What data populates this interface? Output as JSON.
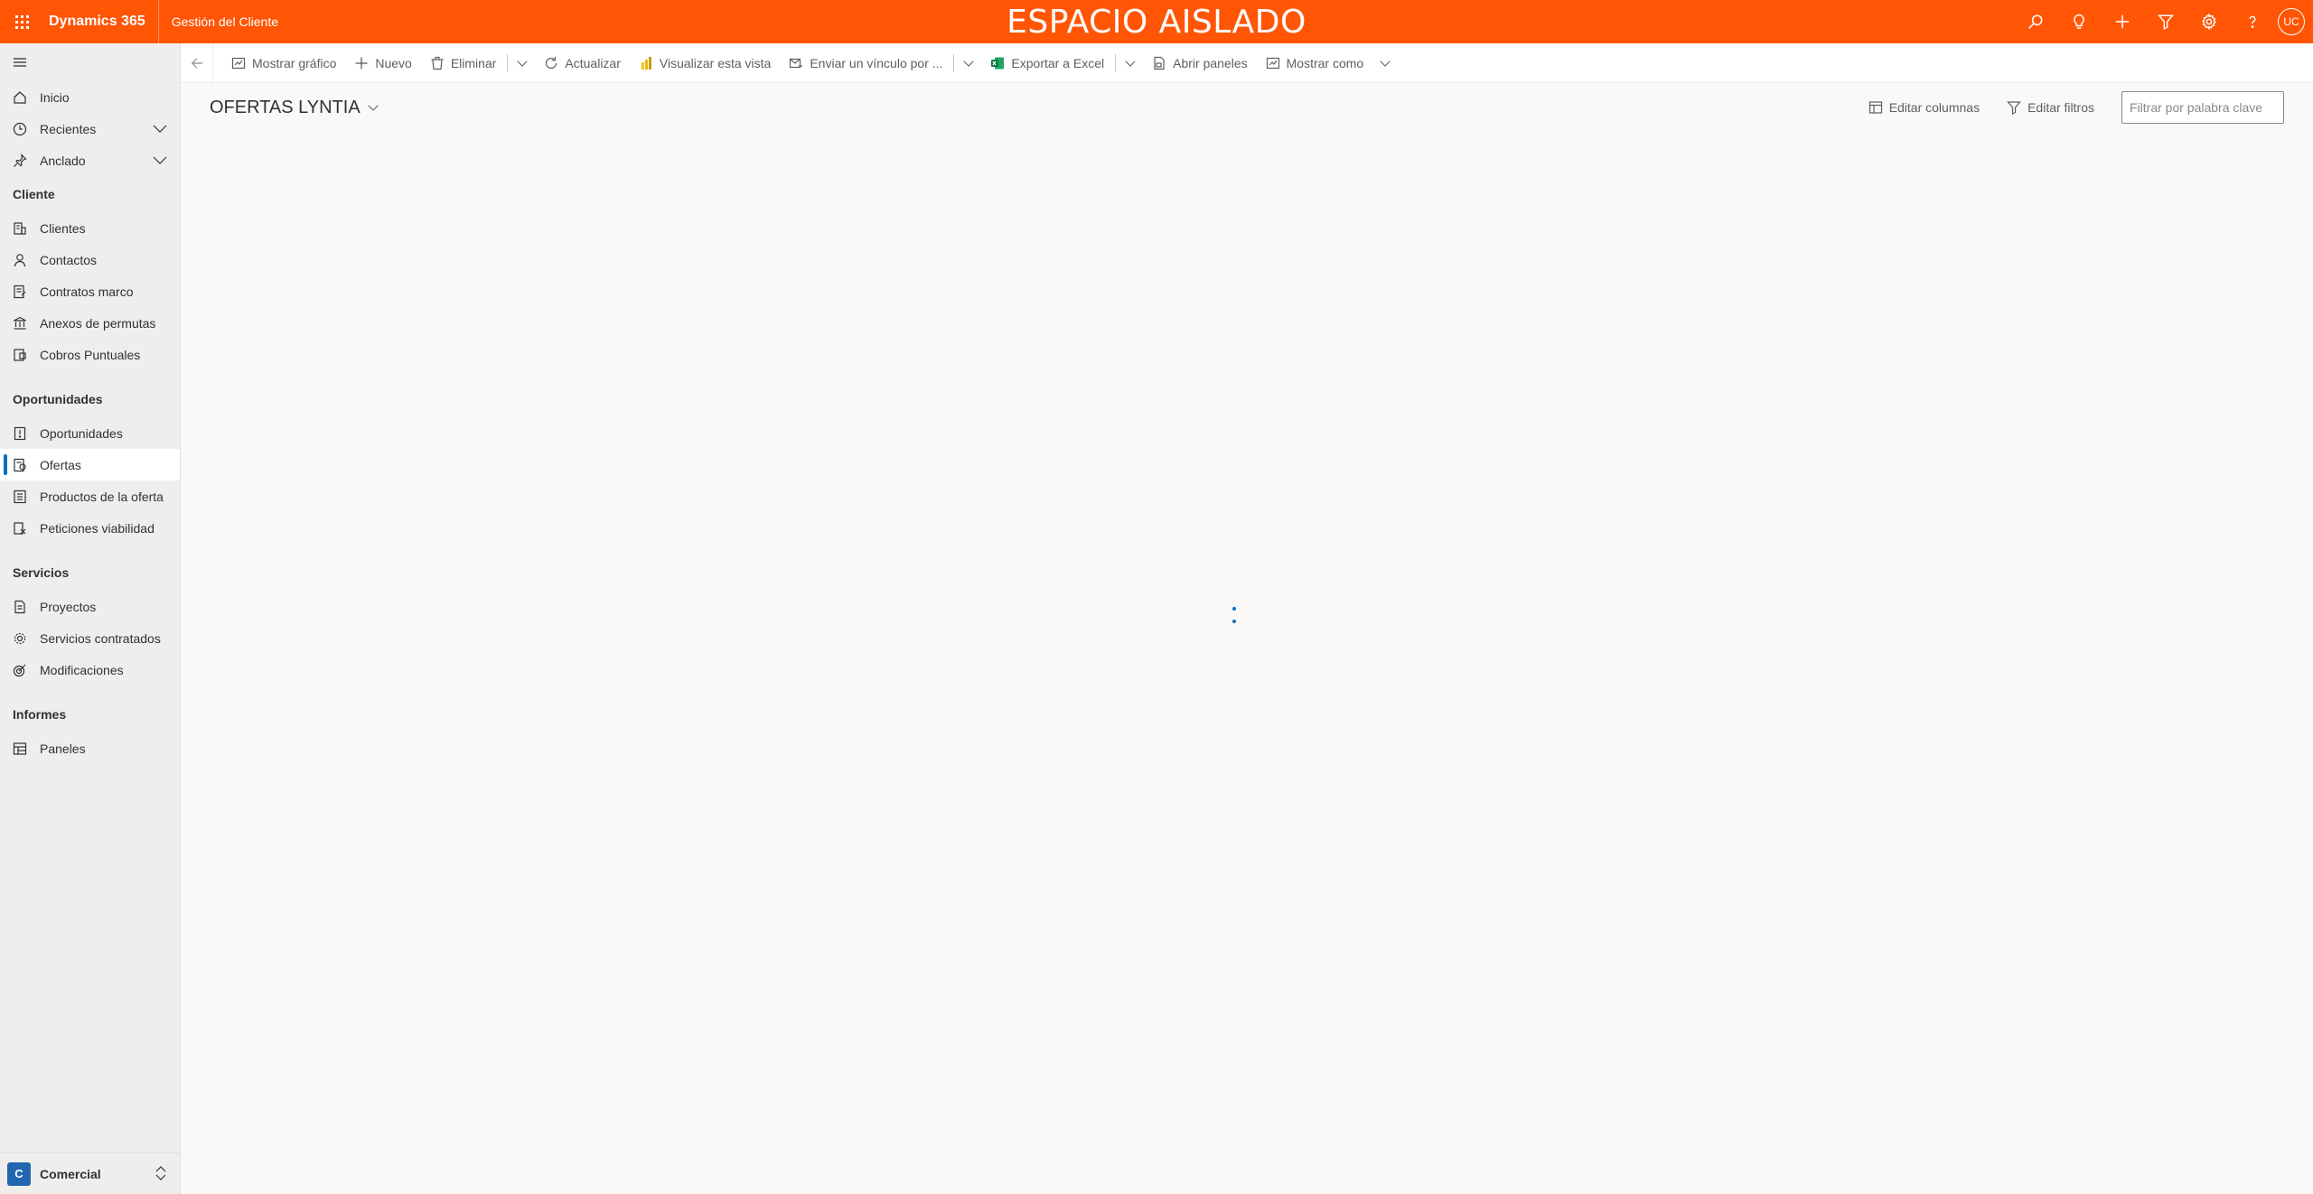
{
  "topbar": {
    "product": "Dynamics 365",
    "app": "Gestión del Cliente",
    "environment_banner": "ESPACIO AISLADO",
    "avatar_initials": "UC",
    "accent_color": "#ff5505",
    "icons": [
      "search-icon",
      "lightbulb-icon",
      "plus-icon",
      "filter-icon",
      "gear-icon",
      "help-icon"
    ]
  },
  "sidebar": {
    "top_items": [
      {
        "label": "Inicio",
        "icon": "home-icon"
      },
      {
        "label": "Recientes",
        "icon": "clock-icon"
      },
      {
        "label": "Anclado",
        "icon": "pin-icon"
      }
    ],
    "groups": [
      {
        "title": "Cliente",
        "items": [
          {
            "label": "Clientes",
            "icon": "building-icon"
          },
          {
            "label": "Contactos",
            "icon": "person-icon"
          },
          {
            "label": "Contratos marco",
            "icon": "contract-icon"
          },
          {
            "label": "Anexos de permutas",
            "icon": "bank-icon"
          },
          {
            "label": "Cobros Puntuales",
            "icon": "receipt-icon"
          }
        ]
      },
      {
        "title": "Oportunidades",
        "items": [
          {
            "label": "Oportunidades",
            "icon": "opportunity-icon"
          },
          {
            "label": "Ofertas",
            "icon": "quote-icon",
            "active": true
          },
          {
            "label": "Productos de la oferta",
            "icon": "list-icon"
          },
          {
            "label": "Peticiones viabilidad",
            "icon": "scale-icon"
          }
        ]
      },
      {
        "title": "Servicios",
        "items": [
          {
            "label": "Proyectos",
            "icon": "document-icon"
          },
          {
            "label": "Servicios contratados",
            "icon": "gear-cluster-icon"
          },
          {
            "label": "Modificaciones",
            "icon": "target-icon"
          }
        ]
      },
      {
        "title": "Informes",
        "items": [
          {
            "label": "Paneles",
            "icon": "dashboard-icon"
          }
        ]
      }
    ],
    "area": {
      "badge": "C",
      "label": "Comercial"
    }
  },
  "commandbar": {
    "show_chart": "Mostrar gráfico",
    "new": "Nuevo",
    "delete": "Eliminar",
    "refresh": "Actualizar",
    "visualize_view": "Visualizar esta vista",
    "email_link": "Enviar un vínculo por ...",
    "export_excel": "Exportar a Excel",
    "open_dashboards": "Abrir paneles",
    "show_as": "Mostrar como"
  },
  "view": {
    "title": "OFERTAS LYNTIA",
    "edit_columns": "Editar columnas",
    "edit_filters": "Editar filtros",
    "search_placeholder": "Filtrar por palabra clave"
  }
}
